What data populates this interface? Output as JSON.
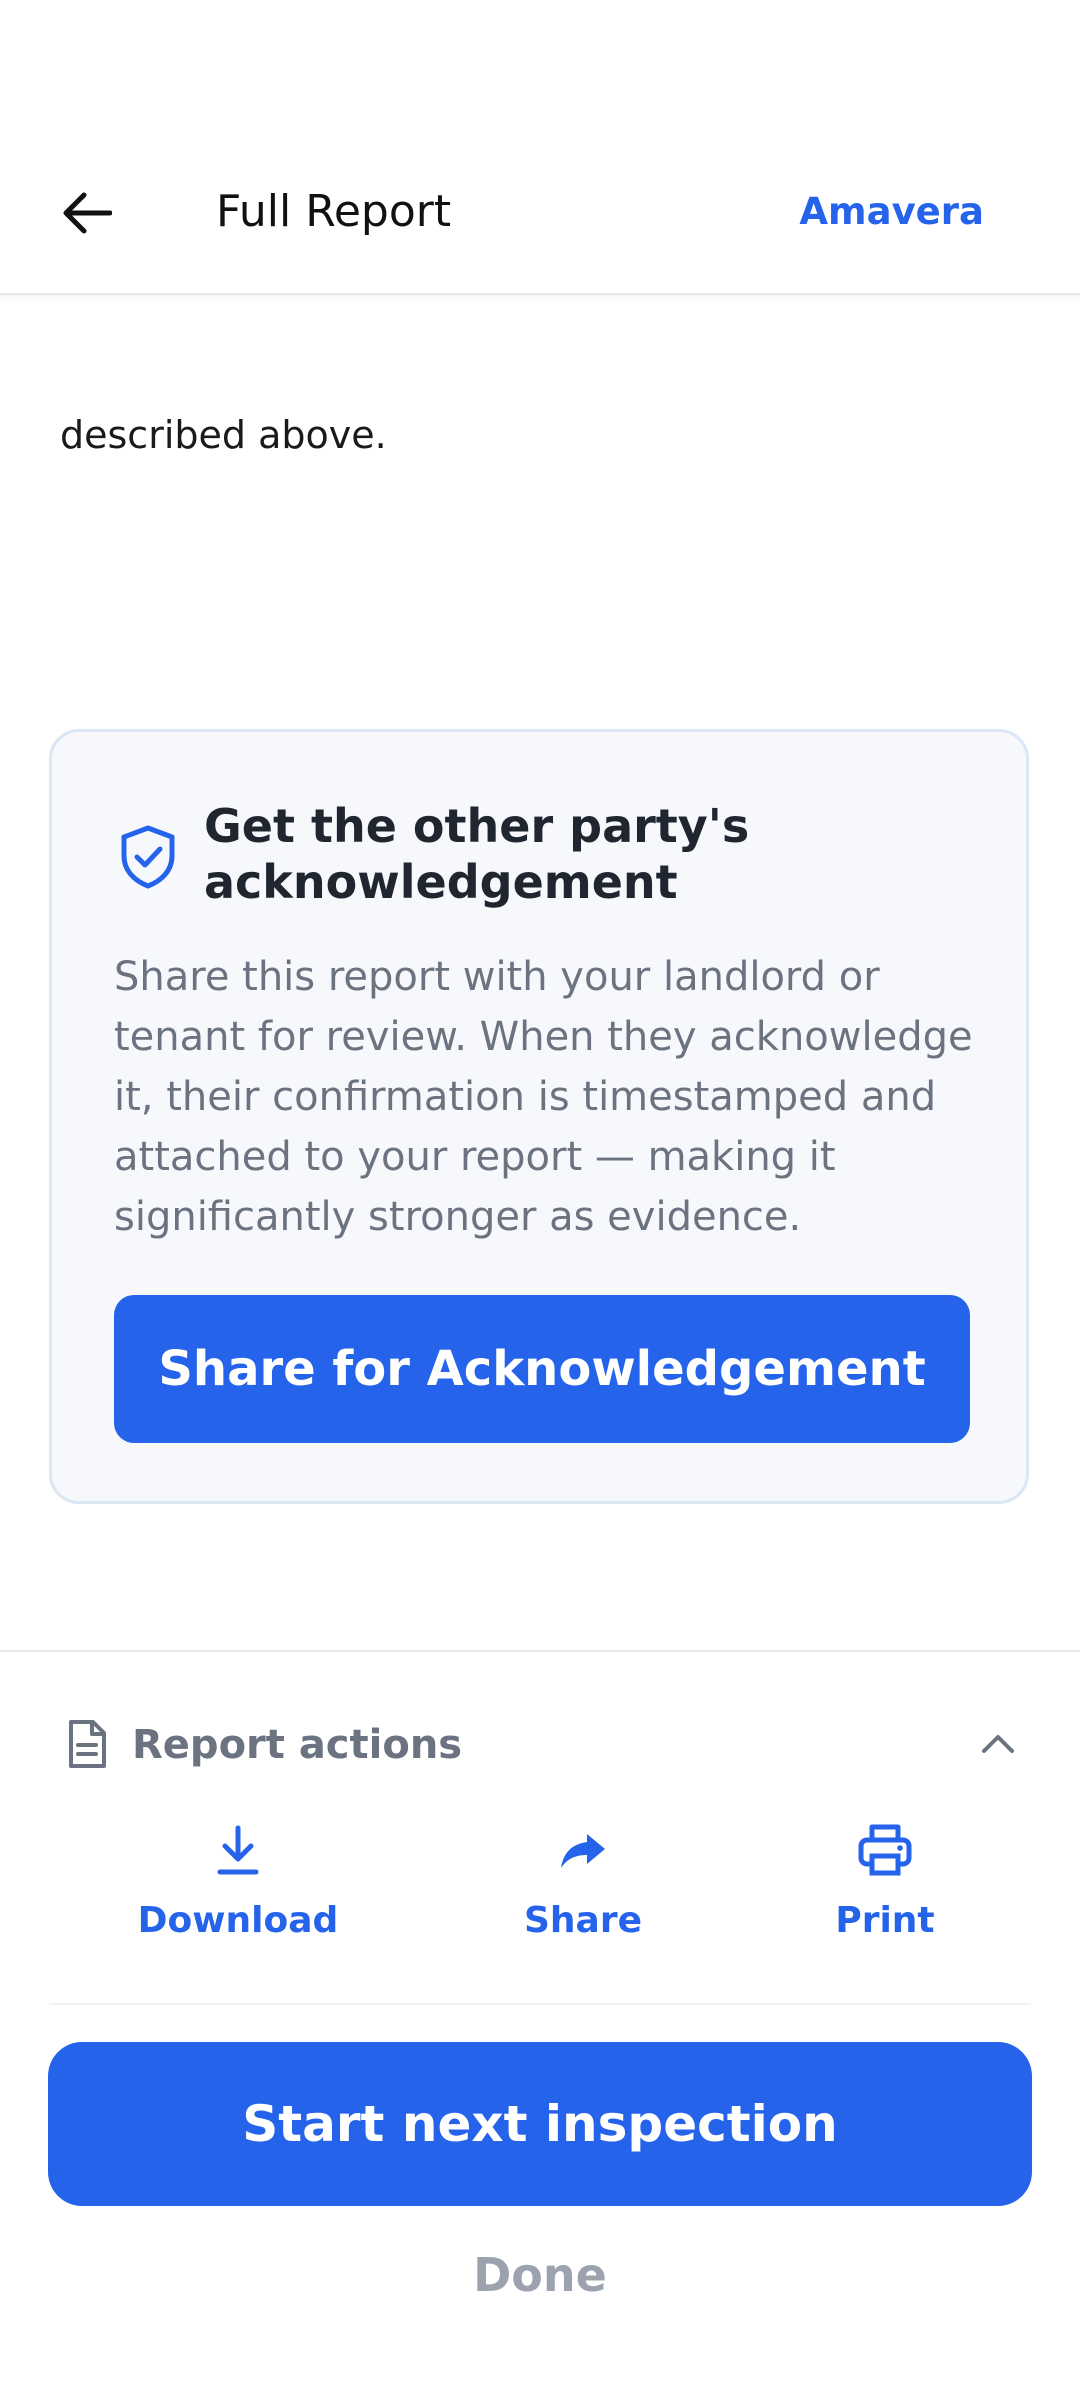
{
  "header": {
    "title": "Full Report",
    "brand": "Amavera",
    "back_icon": "arrow-left-icon"
  },
  "content": {
    "trailing_text": "described above."
  },
  "acknowledgement_card": {
    "icon": "shield-check-icon",
    "title": "Get the other party's acknowledgement",
    "description": "Share this report with your landlord or tenant for review. When they acknowledge it, their confirmation is timestamped and attached to your report — making it significantly stronger as evidence.",
    "button_label": "Share for Acknowledgement"
  },
  "report_actions": {
    "title": "Report actions",
    "icon": "document-icon",
    "toggle_icon": "chevron-up-icon",
    "items": [
      {
        "label": "Download",
        "icon": "download-icon"
      },
      {
        "label": "Share",
        "icon": "share-arrow-icon"
      },
      {
        "label": "Print",
        "icon": "printer-icon"
      }
    ]
  },
  "footer": {
    "primary_label": "Start next inspection",
    "secondary_label": "Done"
  },
  "colors": {
    "accent": "#2563eb",
    "card_bg": "#f6f8fc",
    "card_border": "#dbe6f6",
    "muted_text": "#6b7280",
    "disabled_text": "#9ca3af"
  }
}
